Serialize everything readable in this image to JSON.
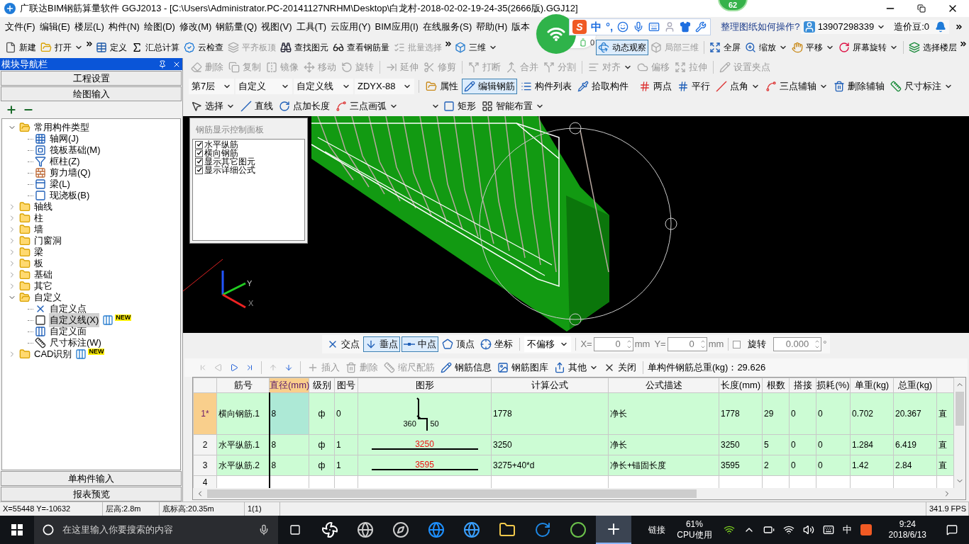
{
  "window": {
    "title": "广联达BIM钢筋算量软件 GGJ2013 - [C:\\Users\\Administrator.PC-20141127NRHM\\Desktop\\白龙村-2018-02-02-19-24-35(2666版).GGJ12]"
  },
  "overlays": {
    "badge": "62",
    "ime": {
      "logo": "S",
      "labels": [
        "中",
        "°,"
      ]
    },
    "wifi_widget": {
      "count": "0"
    }
  },
  "menu": [
    "文件(F)",
    "编辑(E)",
    "楼层(L)",
    "构件(N)",
    "绘图(D)",
    "修改(M)",
    "钢筋量(Q)",
    "视图(V)",
    "工具(T)",
    "云应用(Y)",
    "BIM应用(I)",
    "在线服务(S)",
    "帮助(H)",
    "版本"
  ],
  "help_link": "整理图纸如何操作?",
  "account": {
    "phone": "13907298339",
    "beans": "造价豆:0"
  },
  "main_toolbar": [
    [
      {
        "label": "新建",
        "dropdown": false,
        "disabled": false,
        "selected": false
      },
      {
        "label": "打开",
        "dropdown": true,
        "disabled": false,
        "selected": false
      }
    ],
    [
      {
        "label": "定义",
        "dropdown": false,
        "disabled": false,
        "selected": false
      },
      {
        "label": "汇总计算",
        "dropdown": false,
        "disabled": false,
        "selected": false
      },
      {
        "label": "云检查",
        "dropdown": false,
        "disabled": false,
        "selected": false
      },
      {
        "label": "平齐板顶",
        "dropdown": false,
        "disabled": true,
        "selected": false
      },
      {
        "label": "查找图元",
        "dropdown": false,
        "disabled": false,
        "selected": false
      },
      {
        "label": "查看钢筋量",
        "dropdown": false,
        "disabled": false,
        "selected": false
      },
      {
        "label": "批量选择",
        "dropdown": false,
        "disabled": true,
        "selected": false
      }
    ],
    [
      {
        "label": "三维",
        "dropdown": true,
        "disabled": false,
        "selected": false
      },
      {
        "label": "动态观察",
        "dropdown": false,
        "disabled": false,
        "selected": true
      },
      {
        "label": "局部三维",
        "dropdown": false,
        "disabled": true,
        "selected": false
      },
      {
        "label": "全屏",
        "dropdown": false,
        "disabled": false,
        "selected": false
      },
      {
        "label": "缩放",
        "dropdown": true,
        "disabled": false,
        "selected": false
      },
      {
        "label": "平移",
        "dropdown": true,
        "disabled": false,
        "selected": false
      },
      {
        "label": "屏幕旋转",
        "dropdown": true,
        "disabled": false,
        "selected": false
      },
      {
        "label": "选择楼层",
        "dropdown": false,
        "disabled": false,
        "selected": false
      }
    ]
  ],
  "nav_panel": {
    "title": "模块导航栏",
    "top_buttons": [
      "工程设置",
      "绘图输入"
    ],
    "bottom_buttons": [
      "单构件输入",
      "报表预览"
    ],
    "tree": [
      {
        "label": "常用构件类型",
        "expanded": true,
        "selected": false,
        "children": [
          {
            "label": "轴网(J)",
            "selected": false
          },
          {
            "label": "筏板基础(M)",
            "selected": false
          },
          {
            "label": "框柱(Z)",
            "selected": false
          },
          {
            "label": "剪力墙(Q)",
            "selected": false
          },
          {
            "label": "梁(L)",
            "selected": false
          },
          {
            "label": "现浇板(B)",
            "selected": false
          }
        ]
      },
      {
        "label": "轴线",
        "expanded": false,
        "selected": false
      },
      {
        "label": "柱",
        "expanded": false,
        "selected": false
      },
      {
        "label": "墙",
        "expanded": false,
        "selected": false
      },
      {
        "label": "门窗洞",
        "expanded": false,
        "selected": false
      },
      {
        "label": "梁",
        "expanded": false,
        "selected": false
      },
      {
        "label": "板",
        "expanded": false,
        "selected": false
      },
      {
        "label": "基础",
        "expanded": false,
        "selected": false
      },
      {
        "label": "其它",
        "expanded": false,
        "selected": false
      },
      {
        "label": "自定义",
        "expanded": true,
        "selected": false,
        "children": [
          {
            "label": "自定义点",
            "selected": false
          },
          {
            "label": "自定义线(X)",
            "selected": true,
            "badge": "NEW"
          },
          {
            "label": "自定义面",
            "selected": false
          },
          {
            "label": "尺寸标注(W)",
            "selected": false
          }
        ]
      },
      {
        "label": "CAD识别",
        "expanded": false,
        "selected": false,
        "badge": "NEW"
      }
    ]
  },
  "edit_toolbar": [
    {
      "label": "删除",
      "dropdown": false,
      "disabled": true
    },
    {
      "label": "复制",
      "dropdown": false,
      "disabled": true
    },
    {
      "label": "镜像",
      "dropdown": false,
      "disabled": true
    },
    {
      "label": "移动",
      "dropdown": false,
      "disabled": true
    },
    {
      "label": "旋转",
      "dropdown": false,
      "disabled": true
    },
    {
      "label": "延伸",
      "dropdown": false,
      "disabled": true
    },
    {
      "label": "修剪",
      "dropdown": false,
      "disabled": true
    },
    {
      "label": "打断",
      "dropdown": false,
      "disabled": true
    },
    {
      "label": "合并",
      "dropdown": false,
      "disabled": true
    },
    {
      "label": "分割",
      "dropdown": false,
      "disabled": true
    },
    {
      "label": "对齐",
      "dropdown": true,
      "disabled": true
    },
    {
      "label": "偏移",
      "dropdown": false,
      "disabled": true
    },
    {
      "label": "拉伸",
      "dropdown": false,
      "disabled": true
    },
    {
      "label": "设置夹点",
      "dropdown": false,
      "disabled": true
    }
  ],
  "component_bar": {
    "selects": [
      "第7层",
      "自定义",
      "自定义线",
      "ZDYX-88"
    ],
    "buttons": [
      {
        "label": "属性",
        "selected": false
      },
      {
        "label": "编辑钢筋",
        "selected": true
      },
      {
        "label": "构件列表",
        "selected": false
      },
      {
        "label": "拾取构件",
        "selected": false
      }
    ],
    "axis_tools": [
      {
        "label": "两点",
        "dropdown": false
      },
      {
        "label": "平行",
        "dropdown": false
      },
      {
        "label": "点角",
        "dropdown": true
      },
      {
        "label": "三点辅轴",
        "dropdown": true
      },
      {
        "label": "删除辅轴",
        "dropdown": false
      },
      {
        "label": "尺寸标注",
        "dropdown": true
      }
    ]
  },
  "draw_toolbar": [
    {
      "label": "选择",
      "dropdown": true
    },
    {
      "label": "直线",
      "dropdown": false
    },
    {
      "label": "点加长度",
      "dropdown": false
    },
    {
      "label": "三点画弧",
      "dropdown": true
    },
    {
      "label": "矩形",
      "dropdown": false
    },
    {
      "label": "智能布置",
      "dropdown": true
    }
  ],
  "viewport": {
    "axis_labels": [
      "Y",
      "X"
    ],
    "panel": {
      "title": "钢筋显示控制面板",
      "options": [
        {
          "label": "水平纵筋",
          "checked": true
        },
        {
          "label": "横向钢筋",
          "checked": true
        },
        {
          "label": "显示其它图元",
          "checked": true
        },
        {
          "label": "显示详细公式",
          "checked": true
        }
      ]
    }
  },
  "snap_toolbar": {
    "snaps": [
      {
        "label": "交点",
        "selected": false
      },
      {
        "label": "垂点",
        "selected": true
      },
      {
        "label": "中点",
        "selected": true
      },
      {
        "label": "顶点",
        "selected": false
      },
      {
        "label": "坐标",
        "selected": false
      }
    ],
    "offset": "不偏移",
    "x": {
      "label": "X=",
      "value": "0",
      "unit": "mm"
    },
    "y": {
      "label": "Y=",
      "value": "0",
      "unit": "mm"
    },
    "rotate": {
      "checked": false,
      "label": "旋转",
      "value": "0.000",
      "unit": "°"
    }
  },
  "rebar_toolbar": {
    "nav": [
      {
        "disabled": true
      },
      {
        "disabled": true
      },
      {
        "disabled": false
      },
      {
        "disabled": false
      }
    ],
    "move": [
      {
        "disabled": true
      },
      {
        "disabled": false
      }
    ],
    "buttons": [
      {
        "label": "插入",
        "disabled": true,
        "dropdown": false
      },
      {
        "label": "删除",
        "disabled": true,
        "dropdown": false
      },
      {
        "label": "缩尺配筋",
        "disabled": true,
        "dropdown": false
      },
      {
        "label": "钢筋信息",
        "disabled": false,
        "dropdown": false
      },
      {
        "label": "钢筋图库",
        "disabled": false,
        "dropdown": false
      },
      {
        "label": "其他",
        "disabled": false,
        "dropdown": true
      },
      {
        "label": "关闭",
        "disabled": false,
        "dropdown": false
      }
    ],
    "total": "单构件钢筋总重(kg)：29.626"
  },
  "rebar_table": {
    "columns": [
      {
        "label": "筋号",
        "selected": false
      },
      {
        "label": "直径(mm)",
        "selected": true
      },
      {
        "label": "级别",
        "selected": false
      },
      {
        "label": "图号",
        "selected": false
      },
      {
        "label": "图形",
        "selected": false
      },
      {
        "label": "计算公式",
        "selected": false
      },
      {
        "label": "公式描述",
        "selected": false
      },
      {
        "label": "长度(mm)",
        "selected": false
      },
      {
        "label": "根数",
        "selected": false
      },
      {
        "label": "搭接",
        "selected": false
      },
      {
        "label": "损耗(%)",
        "selected": false
      },
      {
        "label": "单重(kg)",
        "selected": false
      },
      {
        "label": "总重(kg)",
        "selected": false
      }
    ],
    "rows": [
      {
        "marker": "1*",
        "selected": true,
        "shape": {
          "kind": "hook",
          "labels": [
            "360",
            "50"
          ]
        },
        "cells": [
          "横向钢筋.1",
          "8",
          "ф",
          "0",
          "",
          "1778",
          "净长",
          "1778",
          "29",
          "0",
          "0",
          "0.702",
          "20.367",
          "直"
        ]
      },
      {
        "marker": "2",
        "selected": false,
        "shape": {
          "kind": "straight",
          "labels": [
            "3250"
          ]
        },
        "cells": [
          "水平纵筋.1",
          "8",
          "ф",
          "1",
          "",
          "3250",
          "净长",
          "3250",
          "5",
          "0",
          "0",
          "1.284",
          "6.419",
          "直"
        ]
      },
      {
        "marker": "3",
        "selected": false,
        "shape": {
          "kind": "straight",
          "labels": [
            "3595"
          ]
        },
        "cells": [
          "水平纵筋.2",
          "8",
          "ф",
          "1",
          "",
          "3275+40*d",
          "净长+锚固长度",
          "3595",
          "2",
          "0",
          "0",
          "1.42",
          "2.84",
          "直"
        ]
      },
      {
        "marker": "4",
        "selected": false,
        "cells": []
      }
    ]
  },
  "status_bar": [
    "X=55448 Y=-10632",
    "层高:2.8m",
    "底标高:20.35m",
    "1(1)",
    "341.9 FPS"
  ],
  "taskbar": {
    "search_placeholder": "在这里输入你要搜索的内容",
    "apps": [
      {
        "selected": false
      },
      {
        "selected": false
      },
      {
        "selected": false
      },
      {
        "selected": false
      },
      {
        "selected": false
      },
      {
        "selected": false
      },
      {
        "selected": false
      },
      {
        "selected": false
      },
      {
        "selected": true
      }
    ],
    "link": "链接",
    "cpu": {
      "percent": "61%",
      "label": "CPU使用"
    },
    "ime": "中",
    "time": "9:24",
    "date": "2018/6/13"
  }
}
